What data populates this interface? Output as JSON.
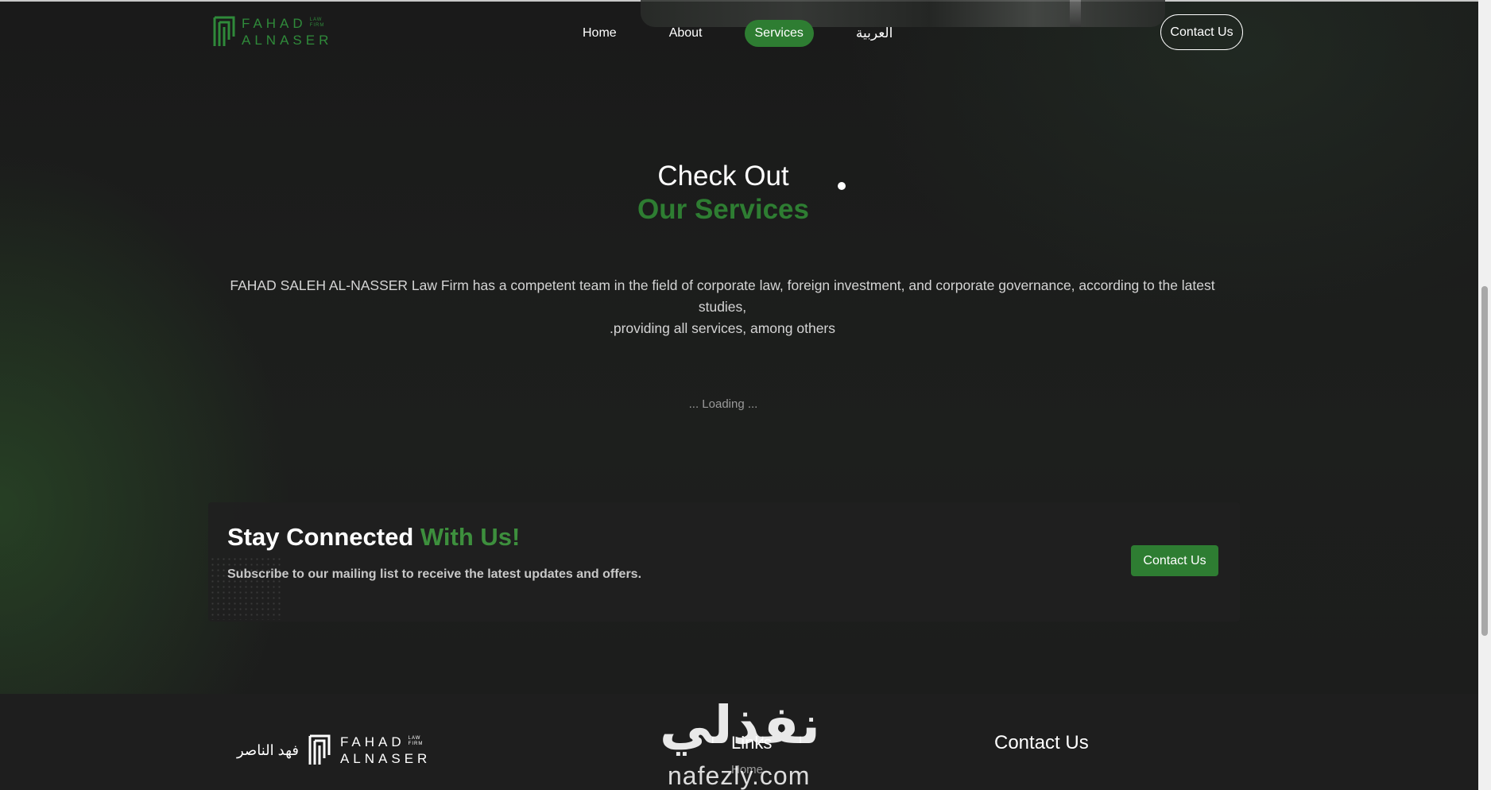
{
  "header": {
    "logo": {
      "line1": "FAHAD",
      "small1": "LAW",
      "small2": "FIRM",
      "line2": "ALNASER"
    },
    "nav": [
      {
        "label": "Home"
      },
      {
        "label": "About"
      },
      {
        "label": "Services",
        "active": true
      },
      {
        "label": "العربية"
      }
    ],
    "contact_button": "Contact Us"
  },
  "services": {
    "title_line1": "Check Out",
    "title_line2": "Our Services",
    "description_line1": "FAHAD SALEH AL-NASSER Law Firm has a competent team in the field of corporate law, foreign investment, and corporate governance, according to the latest studies,",
    "description_line2": ".providing all services, among others",
    "loading": "... Loading ..."
  },
  "newsletter": {
    "title_white": "Stay Connected",
    "title_green": "With Us!",
    "subtitle": "Subscribe to our mailing list to receive the latest updates and offers.",
    "button": "Contact Us"
  },
  "footer": {
    "arabic_name": "فهد الناصر",
    "logo": {
      "line1": "FAHAD",
      "small1": "LAW",
      "small2": "FIRM",
      "line2": "ALNASER"
    },
    "links_title": "Links",
    "links": [
      "Home"
    ],
    "contact_title": "Contact Us"
  },
  "watermark": {
    "arabic": "نفذلي",
    "latin": "nafezly.com"
  },
  "colors": {
    "accent": "#2e7d32",
    "background": "#1b1b1b",
    "text": "#ffffff"
  },
  "icons": {
    "logo": "fahad-alnaser-logo-icon"
  }
}
